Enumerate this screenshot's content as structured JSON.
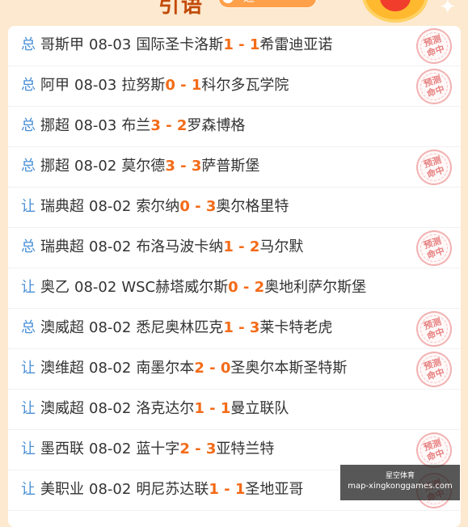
{
  "header": {
    "title_partial": "引语",
    "pill_text": "近一"
  },
  "matches": [
    {
      "type": "总",
      "league": "哥斯甲",
      "date": "08-03",
      "home": "国际圣卡洛斯",
      "home_score": "1",
      "away_score": "1",
      "away": "希雷迪亚诺",
      "hit": true
    },
    {
      "type": "总",
      "league": "阿甲",
      "date": "08-03",
      "home": "拉努斯",
      "home_score": "0",
      "away_score": "1",
      "away": "科尔多瓦学院",
      "hit": true
    },
    {
      "type": "总",
      "league": "挪超",
      "date": "08-03",
      "home": "布兰",
      "home_score": "3",
      "away_score": "2",
      "away": "罗森博格",
      "hit": false
    },
    {
      "type": "总",
      "league": "挪超",
      "date": "08-02",
      "home": "莫尔德",
      "home_score": "3",
      "away_score": "3",
      "away": "萨普斯堡",
      "hit": true
    },
    {
      "type": "让",
      "league": "瑞典超",
      "date": "08-02",
      "home": "索尔纳",
      "home_score": "0",
      "away_score": "3",
      "away": "奥尔格里特",
      "hit": false
    },
    {
      "type": "总",
      "league": "瑞典超",
      "date": "08-02",
      "home": "布洛马波卡纳",
      "home_score": "1",
      "away_score": "2",
      "away": "马尔默",
      "hit": true
    },
    {
      "type": "让",
      "league": "奥乙",
      "date": "08-02",
      "home": "WSC赫塔威尔斯",
      "home_score": "0",
      "away_score": "2",
      "away": "奥地利萨尔斯堡",
      "hit": false
    },
    {
      "type": "总",
      "league": "澳威超",
      "date": "08-02",
      "home": "悉尼奥林匹克",
      "home_score": "1",
      "away_score": "3",
      "away": "莱卡特老虎",
      "hit": true
    },
    {
      "type": "让",
      "league": "澳维超",
      "date": "08-02",
      "home": "南墨尔本",
      "home_score": "2",
      "away_score": "0",
      "away": "圣奥尔本斯圣特斯",
      "hit": true
    },
    {
      "type": "让",
      "league": "澳威超",
      "date": "08-02",
      "home": "洛克达尔",
      "home_score": "1",
      "away_score": "1",
      "away": "曼立联队",
      "hit": false
    },
    {
      "type": "让",
      "league": "墨西联",
      "date": "08-02",
      "home": "蓝十字",
      "home_score": "2",
      "away_score": "3",
      "away": "亚特兰特",
      "hit": true
    },
    {
      "type": "让",
      "league": "美职业",
      "date": "08-02",
      "home": "明尼苏达联",
      "home_score": "1",
      "away_score": "1",
      "away": "圣地亚哥",
      "hit": true
    }
  ],
  "stamp": {
    "line1": "预测",
    "line2": "命中"
  },
  "watermark": {
    "line1": "星空体育",
    "line2": "map-xingkonggames.com"
  },
  "colors": {
    "tag": "#4a90d6",
    "score": "#f36b18",
    "stamp": "#e36b6b",
    "background": "#fde9cf"
  }
}
